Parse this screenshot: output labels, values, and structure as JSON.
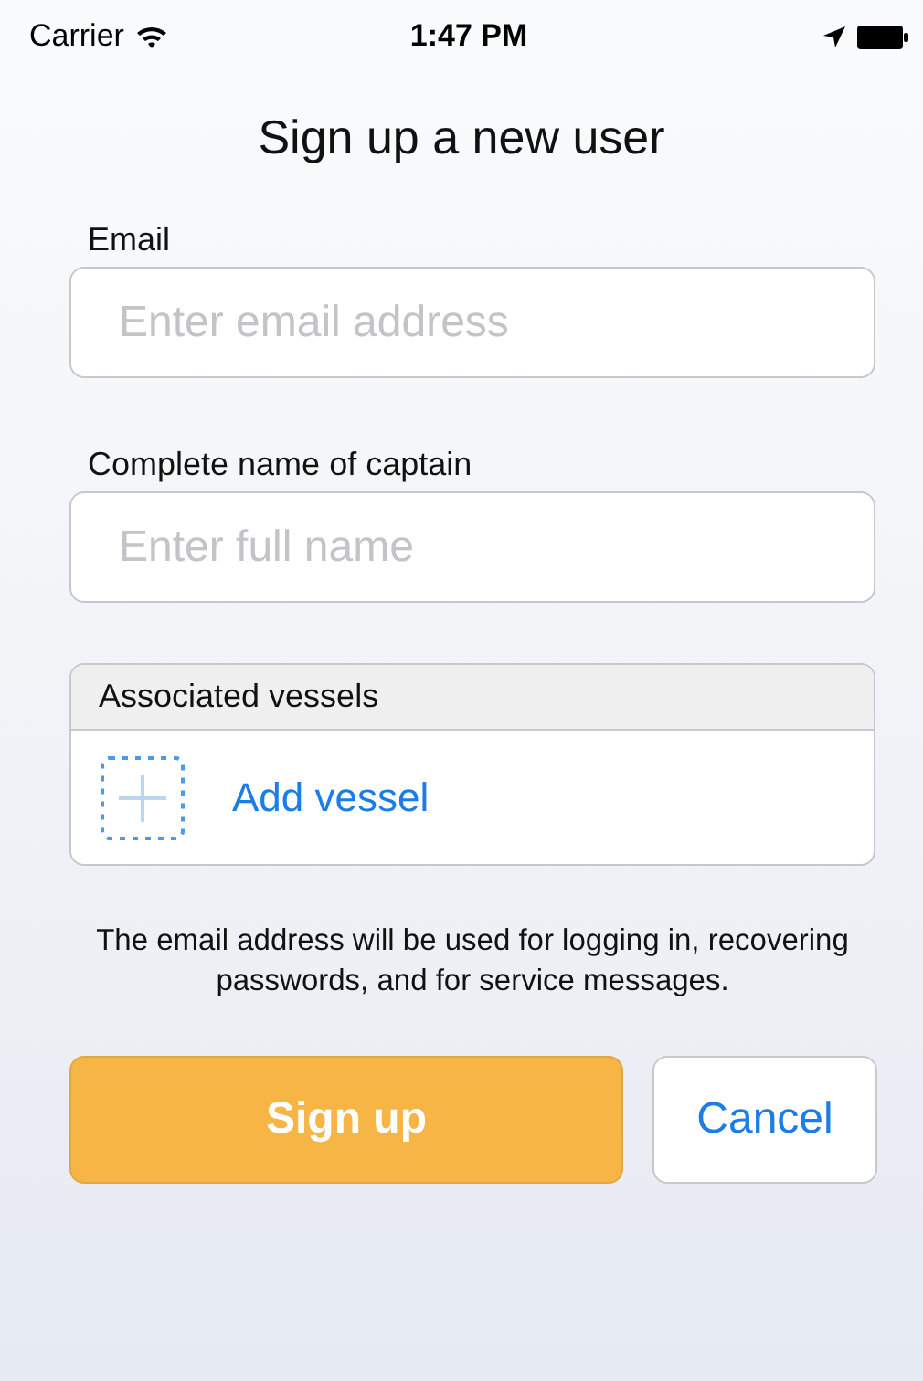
{
  "status_bar": {
    "carrier": "Carrier",
    "time": "1:47 PM"
  },
  "title": "Sign up a new user",
  "fields": [
    {
      "label": "Email",
      "placeholder": "Enter email address"
    },
    {
      "label": "Complete name of captain",
      "placeholder": "Enter full name"
    }
  ],
  "vessels": {
    "header": "Associated vessels",
    "add_label": "Add vessel"
  },
  "note": "The email address will be used for logging in, recovering passwords, and for service messages.",
  "buttons": [
    {
      "kind": "primary",
      "label": "Sign up"
    },
    {
      "kind": "secondary",
      "label": "Cancel"
    }
  ]
}
